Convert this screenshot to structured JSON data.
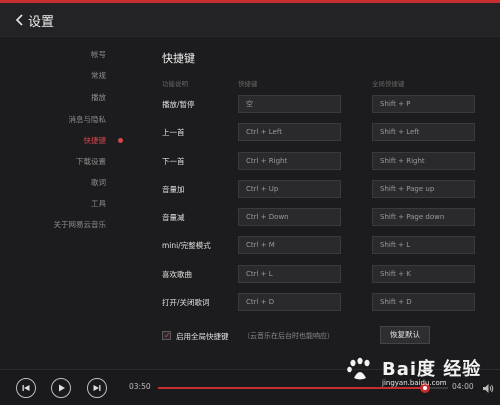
{
  "header": {
    "title": "设置",
    "back_icon": "chevron-left-icon"
  },
  "sidebar": {
    "items": [
      {
        "label": "帐号",
        "active": false
      },
      {
        "label": "常规",
        "active": false
      },
      {
        "label": "播放",
        "active": false
      },
      {
        "label": "消息与隐私",
        "active": false
      },
      {
        "label": "快捷键",
        "active": true
      },
      {
        "label": "下载设置",
        "active": false
      },
      {
        "label": "歌词",
        "active": false
      },
      {
        "label": "工具",
        "active": false
      },
      {
        "label": "关于网易云音乐",
        "active": false
      }
    ]
  },
  "shortcuts": {
    "title": "快捷键",
    "columns": {
      "function": "功能说明",
      "local": "快捷键",
      "global": "全局快捷键"
    },
    "rows": [
      {
        "label": "播放/暂停",
        "local": "空",
        "global": "Shift + P"
      },
      {
        "label": "上一首",
        "local": "Ctrl + Left",
        "global": "Shift + Left"
      },
      {
        "label": "下一首",
        "local": "Ctrl + Right",
        "global": "Shift + Right"
      },
      {
        "label": "音量加",
        "local": "Ctrl + Up",
        "global": "Shift + Page up"
      },
      {
        "label": "音量减",
        "local": "Ctrl + Down",
        "global": "Shift + Page down"
      },
      {
        "label": "mini/完整模式",
        "local": "Ctrl + M",
        "global": "Shift + L"
      },
      {
        "label": "喜欢歌曲",
        "local": "Ctrl + L",
        "global": "Shift + K"
      },
      {
        "label": "打开/关闭歌词",
        "local": "Ctrl + D",
        "global": "Shift + D"
      }
    ],
    "enable_global": {
      "checked": true,
      "label": "启用全局快捷键",
      "hint": "（云音乐在后台时也能响应）"
    },
    "restore_label": "恢复默认"
  },
  "player": {
    "current_time": "03:50",
    "total_time": "04:00",
    "progress": 0.92,
    "buttons": [
      "previous-icon",
      "play-icon",
      "next-icon"
    ]
  },
  "watermark": {
    "title": "Bai度 经验",
    "url": "jingyan.baidu.com"
  },
  "colors": {
    "accent": "#c62f2f",
    "background": "#1c1c1e",
    "active_text": "#d6454c"
  }
}
